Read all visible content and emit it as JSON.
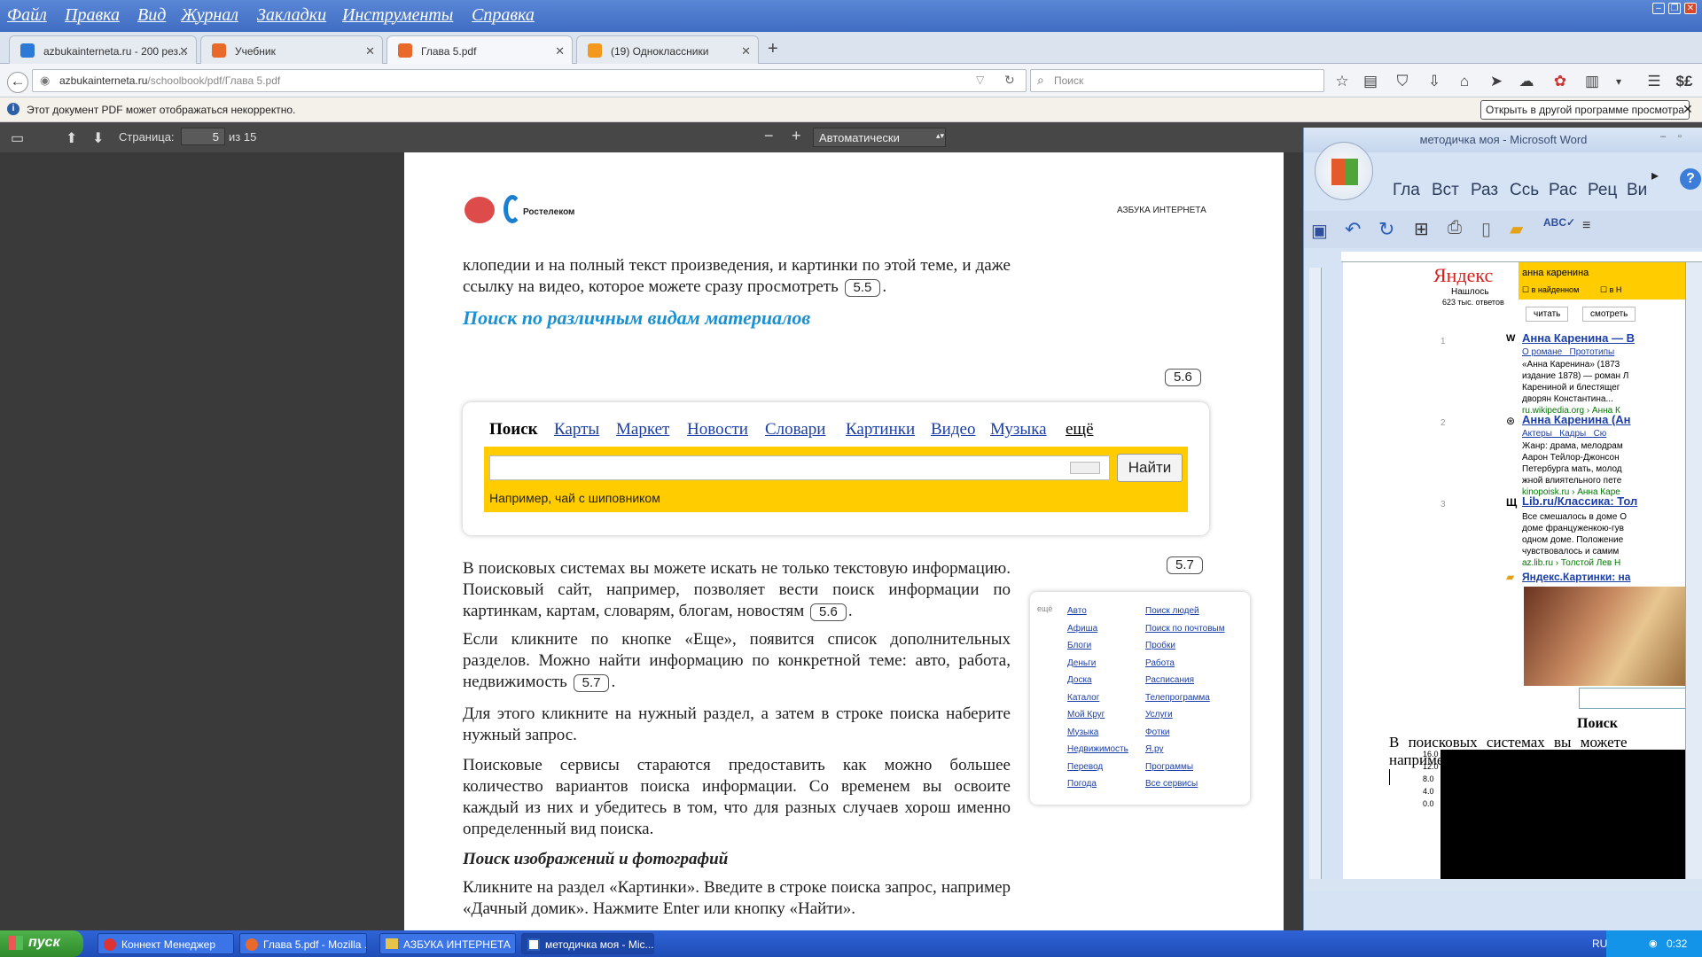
{
  "menubar": {
    "items": [
      "Файл",
      "Правка",
      "Вид",
      "Журнал",
      "Закладки",
      "Инструменты",
      "Справка"
    ]
  },
  "tabs": [
    {
      "label": "azbukainternetа.ru - 200 рез...",
      "icon": "search-icon",
      "color": "#2d7ad6"
    },
    {
      "label": "Учебник",
      "icon": "bookmark-icon",
      "color": "#e8692a"
    },
    {
      "label": "Глава 5.pdf",
      "icon": "pdf-icon",
      "color": "#e8692a"
    },
    {
      "label": "(19) Одноклассники",
      "icon": "ok-icon",
      "color": "#f39a1e"
    }
  ],
  "nav": {
    "url_domain": "azbukainternetа.ru",
    "url_path": "/schoolbook/pdf/Глава 5.pdf",
    "search_placeholder": "Поиск"
  },
  "notification": {
    "text": "Этот документ PDF может отображаться некорректно.",
    "button": "Открыть в другой программе просмотра"
  },
  "pdf_toolbar": {
    "page_label": "Страница:",
    "page_value": "5",
    "page_total": "из 15",
    "zoom": "Автоматически"
  },
  "page": {
    "header_right": "АЗБУКА ИНТЕРНЕТА",
    "logo_text": "Ростелеком",
    "para0_a": "клопедии и на полный текст произведения, и картинки по этой теме, и даже ссылку на видео, которое можете сразу просмотреть",
    "ref55": "5.5",
    "heading1": "Поиск по различным видам материалов",
    "ref56_top": "5.6",
    "ref57_top": "5.7",
    "para1": "В поисковых системах вы можете искать не только текстовую информацию. Поисковый сайт, например, позволяет вести поиск информации по картинкам, картам, словарям, блогам, новостям",
    "ref56": "5.6",
    "para2": "Если кликните по кнопке «Еще», появится список дополнительных разделов. Можно найти информацию по конкретной теме: авто, работа, недвижимость",
    "ref57": "5.7",
    "para3": "Для этого кликните на нужный раздел, а затем в строке поиска наберите нужный запрос.",
    "para4": "Поисковые сервисы стараются предоставить как можно большее количество вариантов поиска информации. Со временем вы освоите каждый из них и убедитесь в том, что для разных случаев хорош именно определенный вид поиска.",
    "heading2": "Поиск изображений и фотографий",
    "para5": "Кликните на раздел «Картинки». Введите в строке поиска запрос, например «Дачный домик». Нажмите Enter или кнопку «Найти»."
  },
  "yandex_fig": {
    "tabs": [
      "Поиск",
      "Карты",
      "Маркет",
      "Новости",
      "Словари",
      "Картинки",
      "Видео",
      "Музыка",
      "ещё"
    ],
    "button": "Найти",
    "example": "Например, чай с шиповником"
  },
  "services_fig": {
    "col1": [
      "Авто",
      "Афиша",
      "Блоги",
      "Деньги",
      "Доска",
      "Каталог",
      "Мой Круг",
      "Музыка",
      "Недвижимость",
      "Перевод",
      "Погода"
    ],
    "col2": [
      "Поиск людей",
      "Поиск по почтовым",
      "Пробки",
      "Работа",
      "Расписания",
      "Телепрограмма",
      "Услуги",
      "Фотки",
      "Я.ру",
      "Программы",
      "Все сервисы"
    ]
  },
  "word": {
    "title": "методичка моя - Microsoft Word",
    "ribbon_tabs": [
      "Гла",
      "Вст",
      "Раз",
      "Ссь",
      "Рас",
      "Рец",
      "Ви"
    ],
    "yandex_brand": "Яндекс",
    "found": "Нашлось",
    "found_count": "623 тыс. ответов",
    "query": "анна каренина",
    "btn_read": "читать",
    "btn_watch": "смотреть",
    "check1": "в найденном",
    "check2": "в Н",
    "r1_title": "Анна Каренина — В",
    "r1_links": "О романе   Прототипы",
    "r1_snip1": "«Анна Каренина» (1873",
    "r1_snip2": "издание 1878) — роман Л",
    "r1_snip3": "Карениной и блестящег",
    "r1_snip4": "дворян Константина...",
    "r1_url": "ru.wikipedia.org › Анна К",
    "r2_title": "Анна Каренина (Ан",
    "r2_links": "Актеры   Кадры   Сю",
    "r2_snip1": "Жанр: драма, мелодрам",
    "r2_snip2": "Аарон Тейлор-Джонсон",
    "r2_snip3": "Петербурга мать, молод",
    "r2_snip4": "жной влиятельного пете",
    "r2_url": "kinopoisk.ru › Анна Каре",
    "r3_title": "Lib.ru/Классика: Тол",
    "r3_snip1": "Все смешалось в доме О",
    "r3_snip2": "доме француженкою-гув",
    "r3_snip3": "одном доме. Положение",
    "r3_snip4": "чувствовалось и самим",
    "r3_url": "az.lib.ru › Толстой Лев Н",
    "r4_title": "Яндекс.Картинки: на",
    "num1": "1",
    "num2": "2",
    "num3": "3",
    "bold_heading": "Поиск",
    "doc_line1": "В поисковых системах вы можете",
    "doc_line2": "например, позволяет вести поиск ин",
    "chart_labels": [
      "16.0",
      "12.0",
      "8.0",
      "4.0",
      "0.0"
    ]
  },
  "taskbar": {
    "start": "пуск",
    "tasks": [
      "Коннект Менеджер",
      "Глава 5.pdf - Mozilla ...",
      "АЗБУКА ИНТЕРНЕТА",
      "методичка моя - Mic..."
    ],
    "lang": "RU",
    "time": "0:32"
  }
}
